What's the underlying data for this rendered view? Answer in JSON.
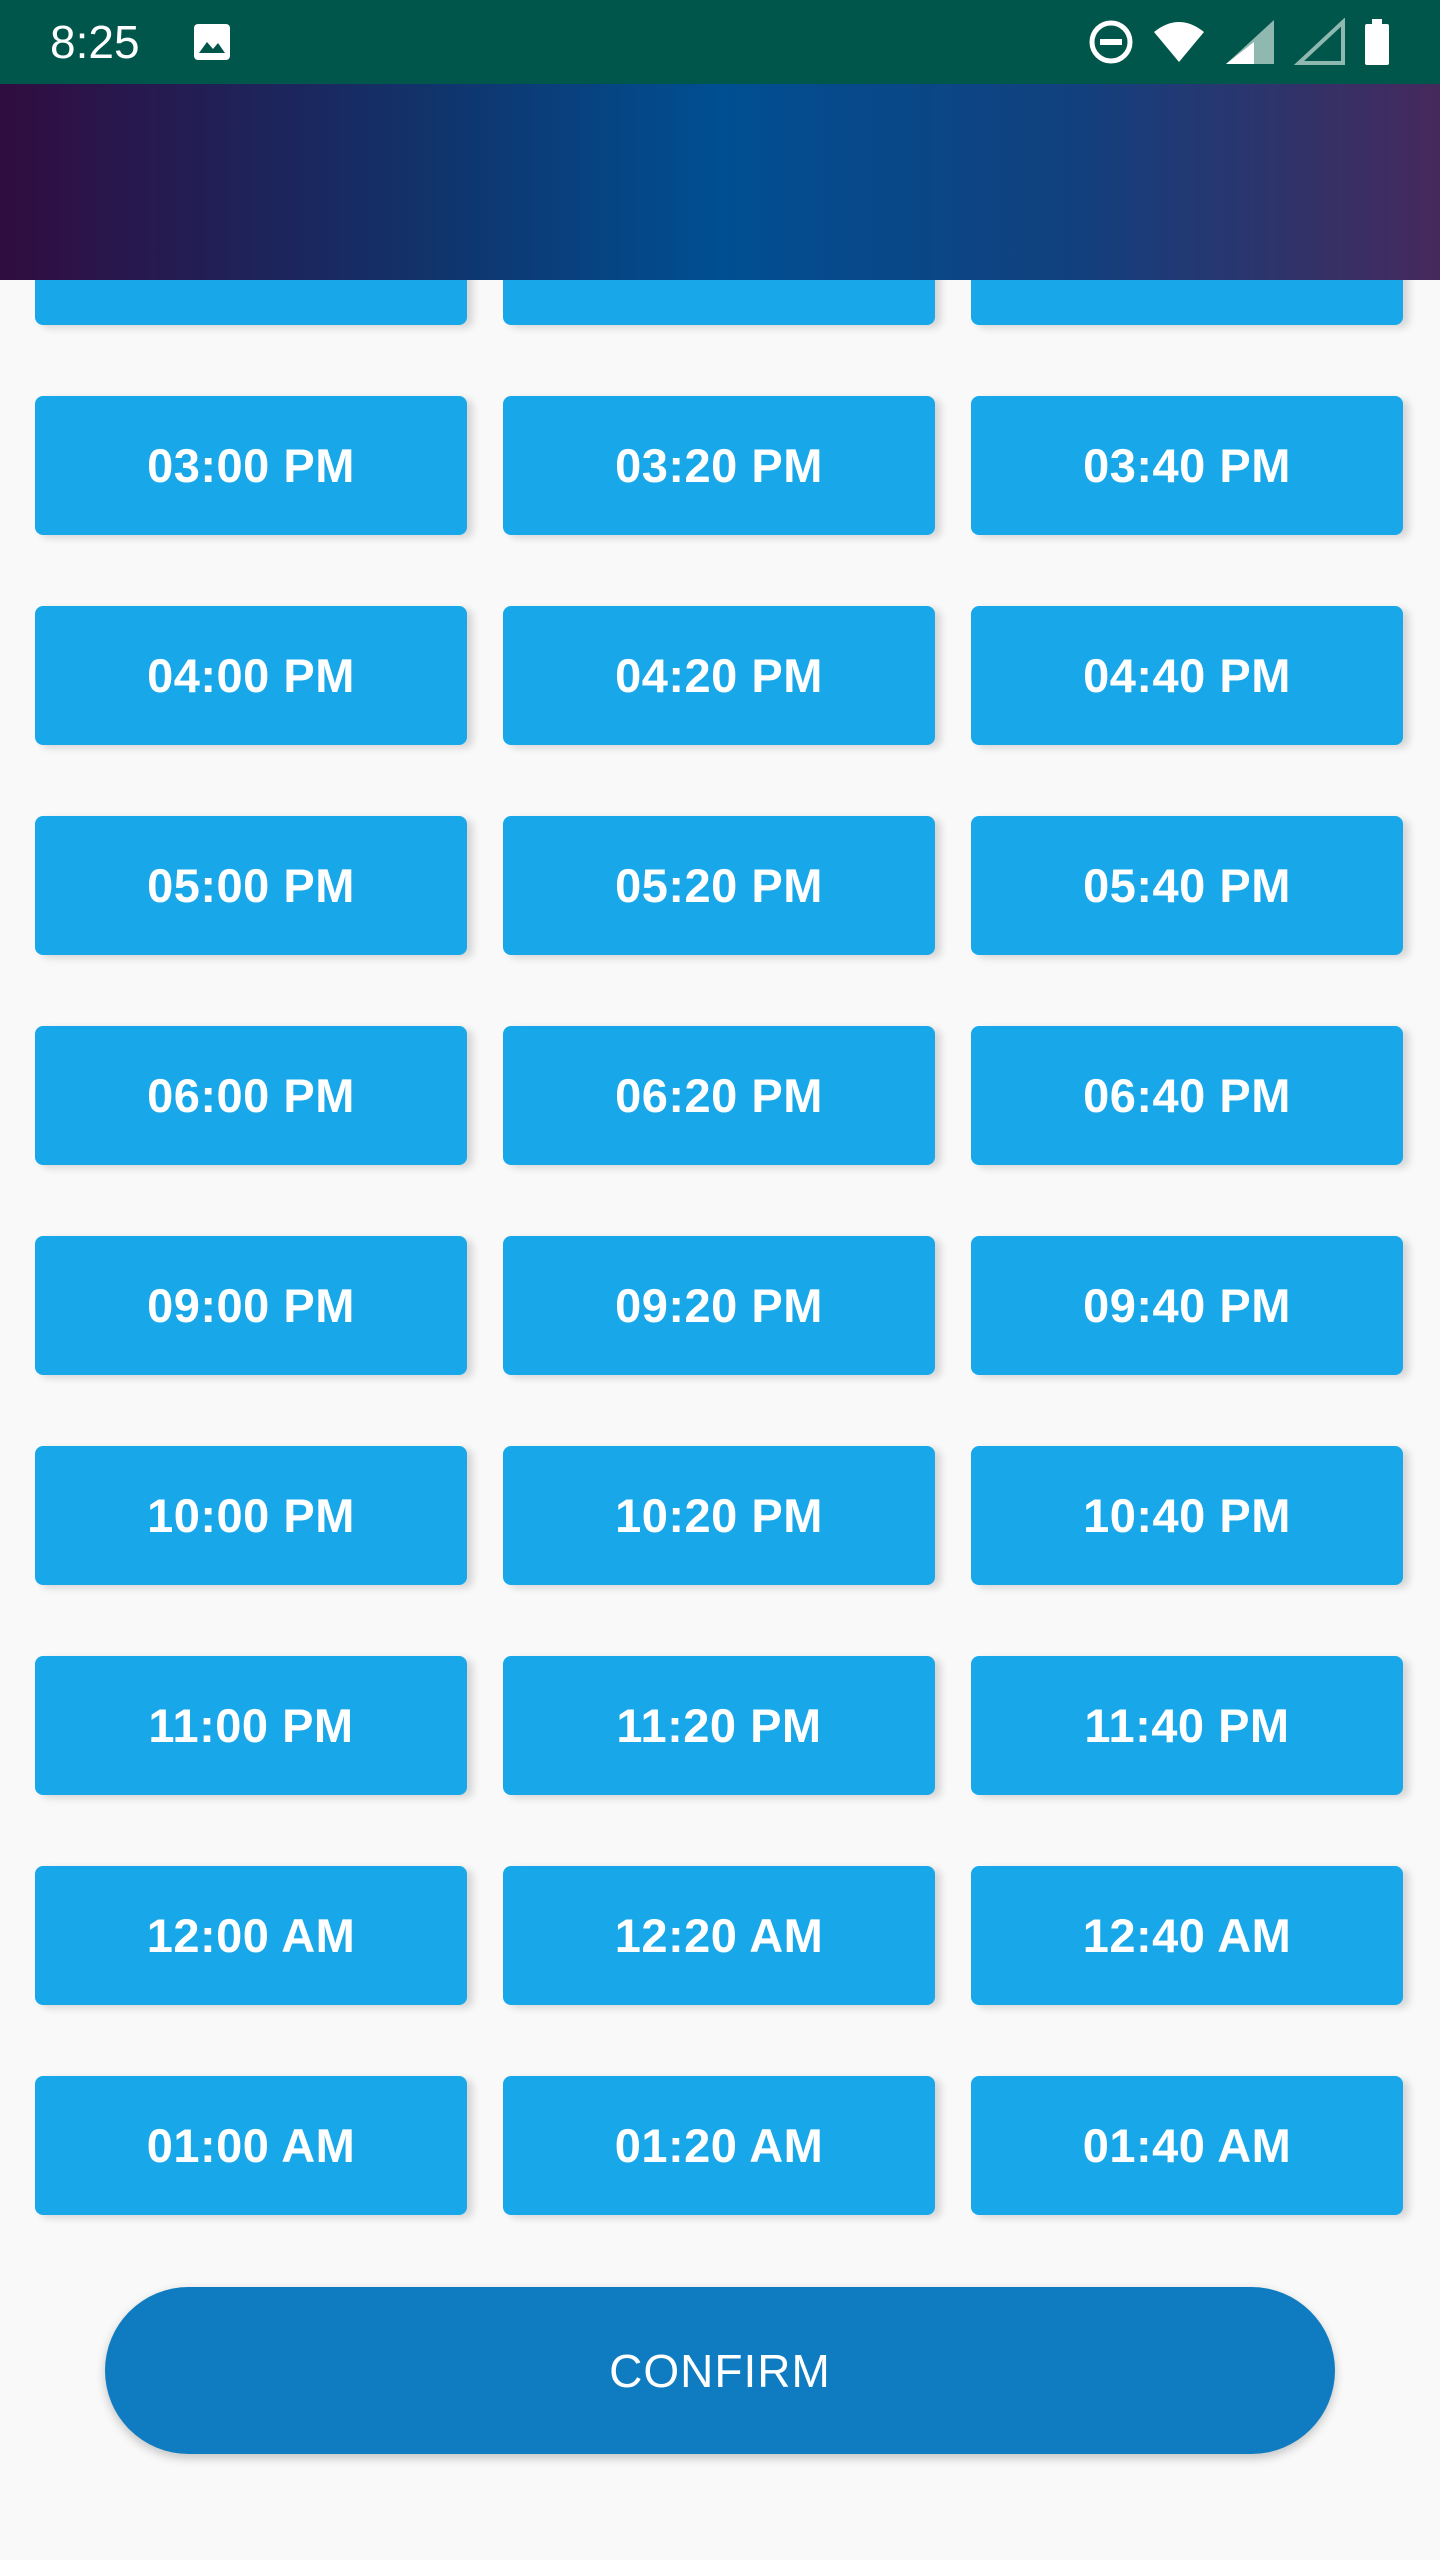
{
  "status_bar": {
    "time": "8:25"
  },
  "icons": {
    "image": "image-icon",
    "dnd": "do-not-disturb-icon",
    "wifi": "wifi-icon",
    "signal": "signal-icon",
    "signal_empty": "signal-empty-icon",
    "battery": "battery-icon"
  },
  "colors": {
    "status_bar": "#01564b",
    "slot": "#18a8ea",
    "confirm": "#0f7cc1"
  },
  "time_slots": [
    {
      "label": ""
    },
    {
      "label": ""
    },
    {
      "label": ""
    },
    {
      "label": "03:00 PM"
    },
    {
      "label": "03:20 PM"
    },
    {
      "label": "03:40 PM"
    },
    {
      "label": "04:00 PM"
    },
    {
      "label": "04:20 PM"
    },
    {
      "label": "04:40 PM"
    },
    {
      "label": "05:00 PM"
    },
    {
      "label": "05:20 PM"
    },
    {
      "label": "05:40 PM"
    },
    {
      "label": "06:00 PM"
    },
    {
      "label": "06:20 PM"
    },
    {
      "label": "06:40 PM"
    },
    {
      "label": "09:00 PM"
    },
    {
      "label": "09:20 PM"
    },
    {
      "label": "09:40 PM"
    },
    {
      "label": "10:00 PM"
    },
    {
      "label": "10:20 PM"
    },
    {
      "label": "10:40 PM"
    },
    {
      "label": "11:00 PM"
    },
    {
      "label": "11:20 PM"
    },
    {
      "label": "11:40 PM"
    },
    {
      "label": "12:00 AM"
    },
    {
      "label": "12:20 AM"
    },
    {
      "label": "12:40 AM"
    },
    {
      "label": "01:00 AM"
    },
    {
      "label": "01:20 AM"
    },
    {
      "label": "01:40 AM"
    }
  ],
  "confirm_label": "CONFIRM"
}
